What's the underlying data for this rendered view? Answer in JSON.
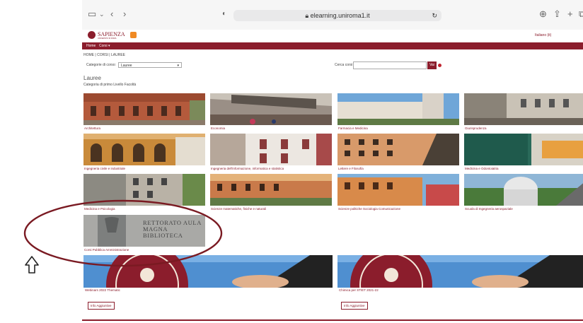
{
  "browser": {
    "url": "elearning.uniroma1.it"
  },
  "site": {
    "logo_text": "SAPIENZA",
    "logo_sub": "UNIVERSITÀ DI ROMA",
    "language": "Italiano (it)"
  },
  "nav": {
    "home": "Home",
    "corsi": "Corsi ▾"
  },
  "breadcrumb": [
    "HOME",
    "CORSI",
    "LAUREE"
  ],
  "filter": {
    "category_label": "Categorie di corso:",
    "category_value": "Lauree",
    "search_label": "Cerca corsi",
    "search_button": "Vai"
  },
  "page": {
    "heading": "Lauree",
    "subheading": "Categoria di primo Livello Facoltà"
  },
  "categories": [
    {
      "label": "Architettura"
    },
    {
      "label": "Economia"
    },
    {
      "label": "Farmacia e Medicina"
    },
    {
      "label": "Giurisprudenza"
    },
    {
      "label": "Ingegneria civile e industriale"
    },
    {
      "label": "Ingegneria dell'informazione, informatica e statistica"
    },
    {
      "label": "Lettere e Filosofia"
    },
    {
      "label": "Medicina e Odontoiatria"
    },
    {
      "label": "Medicina e Psicologia"
    },
    {
      "label": "Scienze matematiche, fisiche e naturali"
    },
    {
      "label": "Scienze politiche Sociologia Comunicazione"
    },
    {
      "label": "Scuola di Ingegneria aerospaziale"
    },
    {
      "label": "Corsi Pubblica Amministrazione",
      "sign": "RETTORATO AULA MAGNA BIBLIOTECA"
    }
  ],
  "featured": [
    {
      "label": "Webinars 2022 Thematic",
      "button": "Info Aggiuntive"
    },
    {
      "label": "Chimica per ST/ET 2021-22",
      "button": "Info Aggiuntive"
    }
  ],
  "colors": {
    "brand": "#8b1d2c",
    "annotation": "#7a1a22"
  }
}
